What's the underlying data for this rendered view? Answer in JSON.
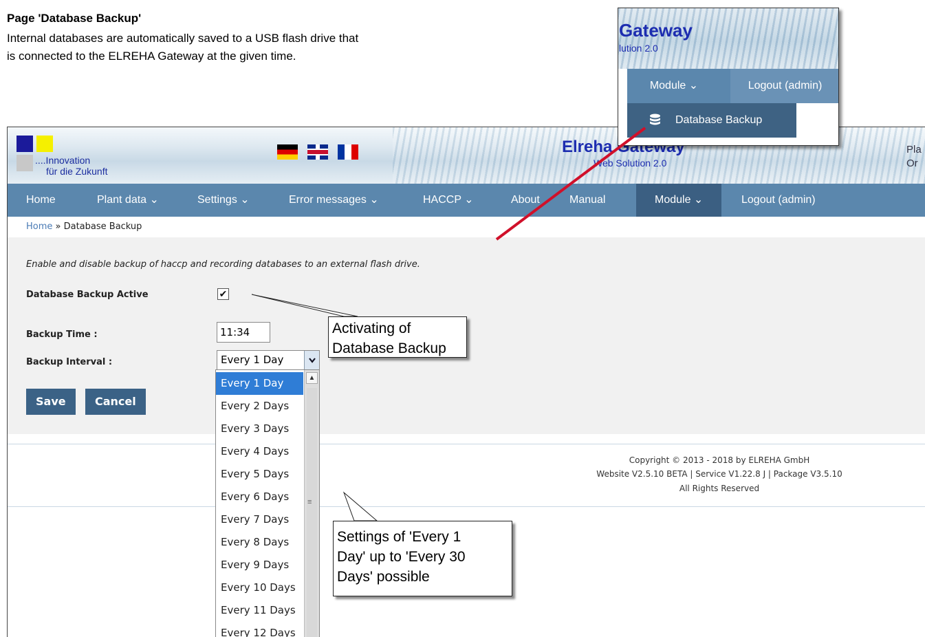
{
  "doc": {
    "title": "Page 'Database Backup'",
    "description_line1": "Internal databases are automatically saved to a USB flash drive that",
    "description_line2": "is connected to the ELREHA Gateway at the given time."
  },
  "header": {
    "logo_line1": "....Innovation",
    "logo_line2": "für die Zukunft",
    "brand_title": "Elreha Gateway",
    "brand_subtitle": "Web Solution 2.0",
    "right_text_line1": "Pla",
    "right_text_line2": "Or"
  },
  "nav": {
    "home": "Home",
    "plant_data": "Plant data ⌄",
    "settings": "Settings ⌄",
    "error_messages": "Error messages ⌄",
    "haccp": "HACCP ⌄",
    "about": "About",
    "manual": "Manual",
    "module": "Module ⌄",
    "logout": "Logout (admin)"
  },
  "breadcrumb": {
    "home": "Home",
    "separator": " » ",
    "current": "Database Backup"
  },
  "form": {
    "intro": "Enable and disable backup of haccp and recording databases to an external flash drive.",
    "backup_active_label": "Database Backup Active",
    "backup_active_checked": true,
    "checkbox_mark": "✔",
    "backup_time_label": "Backup Time :",
    "backup_time_value": "11:34",
    "backup_interval_label": "Backup Interval :",
    "backup_interval_value": "Every 1 Day",
    "save_label": "Save",
    "cancel_label": "Cancel"
  },
  "dropdown": {
    "options": [
      "Every 1 Day",
      "Every 2 Days",
      "Every 3 Days",
      "Every 4 Days",
      "Every 5 Days",
      "Every 6 Days",
      "Every 7 Days",
      "Every 8 Days",
      "Every 9 Days",
      "Every 10 Days",
      "Every 11 Days",
      "Every 12 Days"
    ],
    "selected_index": 0
  },
  "footer": {
    "line1": "Copyright © 2013 - 2018 by ELREHA GmbH",
    "line2": "Website V2.5.10 BETA | Service V1.22.8 J | Package V3.5.10",
    "line3": "All Rights Reserved"
  },
  "inset": {
    "title": "Gateway",
    "subtitle": "lution 2.0",
    "module": "Module ⌄",
    "logout": "Logout (admin)",
    "menu_item": "Database Backup"
  },
  "callouts": {
    "activating_line1": "Activating of",
    "activating_line2": "Database Backup",
    "settings_line1": "Settings of 'Every 1",
    "settings_line2": "Day' up to 'Every 30",
    "settings_line3": "Days' possible"
  },
  "colors": {
    "nav_bar": "#5b87ad",
    "nav_active": "#3b5f82",
    "button": "#3b6286",
    "selected_option": "#2f7dd6",
    "brand_blue": "#1d2db0",
    "pointer_red": "#d0102a"
  }
}
